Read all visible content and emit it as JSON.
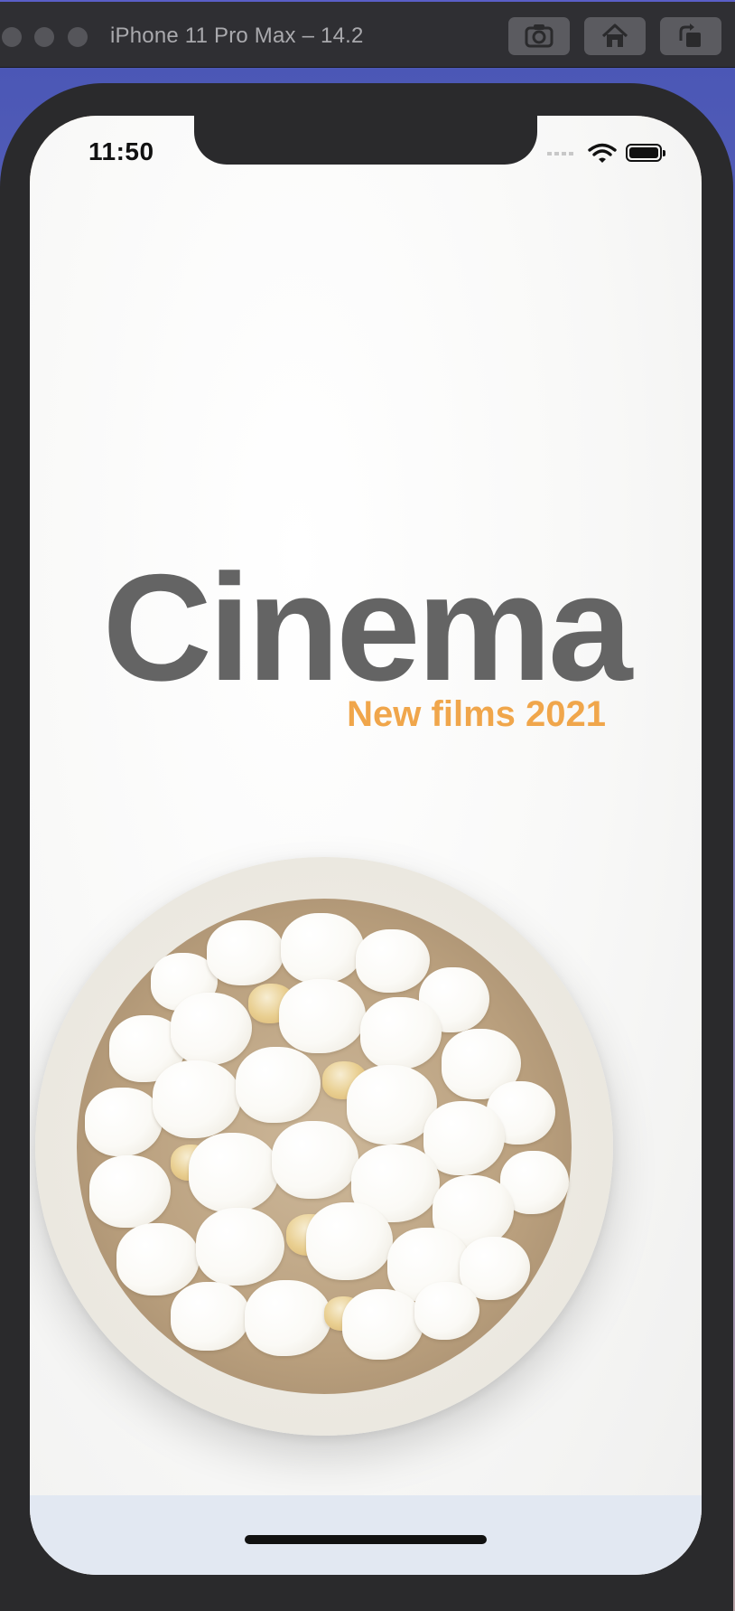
{
  "simulator": {
    "window_title": "iPhone 11 Pro Max – 14.2",
    "buttons": [
      {
        "icon": "screenshot-icon"
      },
      {
        "icon": "home-icon"
      },
      {
        "icon": "rotate-icon"
      }
    ]
  },
  "status_bar": {
    "time": "11:50",
    "icons": [
      "cellular-signal-icon",
      "wifi-icon",
      "battery-icon"
    ]
  },
  "app": {
    "title": "Cinema",
    "subtitle": "New films 2021",
    "hero_image": "popcorn-bowl-image"
  },
  "colors": {
    "title_gray": "#646464",
    "subtitle_orange": "#f0a64b",
    "screen_background": "#fbfbfa",
    "bottom_bar": "#e2e8f2"
  }
}
